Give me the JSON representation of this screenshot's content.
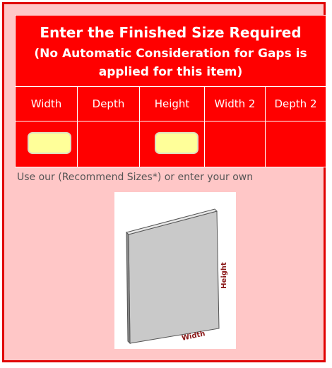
{
  "form": {
    "title": "Enter the Finished Size Required",
    "subtitle": "(No Automatic Consideration for Gaps is applied for this item)",
    "columns": [
      "Width",
      "Depth",
      "Height",
      "Width 2",
      "Depth 2"
    ],
    "inputs": {
      "width": "",
      "height": ""
    },
    "hint": "Use our (Recommend Sizes*) or enter your own"
  },
  "diagram": {
    "width_label": "Width",
    "height_label": "Height"
  },
  "colors": {
    "panel": "#ff0000",
    "frame": "#e00000",
    "background": "#ffc7c7",
    "input": "#ffff99",
    "label": "#8b1a1a"
  }
}
